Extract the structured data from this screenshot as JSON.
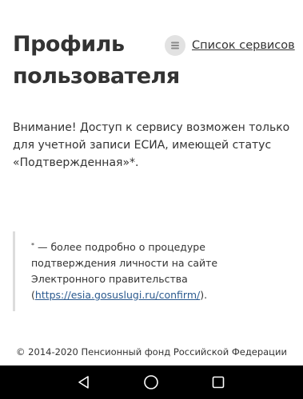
{
  "header": {
    "title_line1": "Профиль",
    "title_line2": "пользователя",
    "services_link_label": "Список сервисов",
    "services_icon": "list-icon"
  },
  "notice": {
    "text": "Внимание! Доступ к сервису возможен только для учетной записи ЕСИА, имеющей статус «Подтвержденная»*."
  },
  "footnote": {
    "asterisk": "*",
    "text_before_link": " — более подробно о процедуре подтверждения личности на сайте Электронного правительства (",
    "link_text": "https://esia.gosuslugi.ru/confirm/",
    "text_after_link": ")."
  },
  "footer": {
    "copyright": "© 2014-2020 Пенсионный фонд Российской Федерации"
  },
  "navbar": {
    "back_icon": "back-triangle-icon",
    "home_icon": "home-circle-icon",
    "recents_icon": "recents-square-icon"
  },
  "colors": {
    "text": "#333333",
    "link": "#2b5a8f",
    "icon_bg": "#e2e2e2",
    "footnote_border": "#dcdcdc",
    "navbar_bg": "#000000"
  }
}
